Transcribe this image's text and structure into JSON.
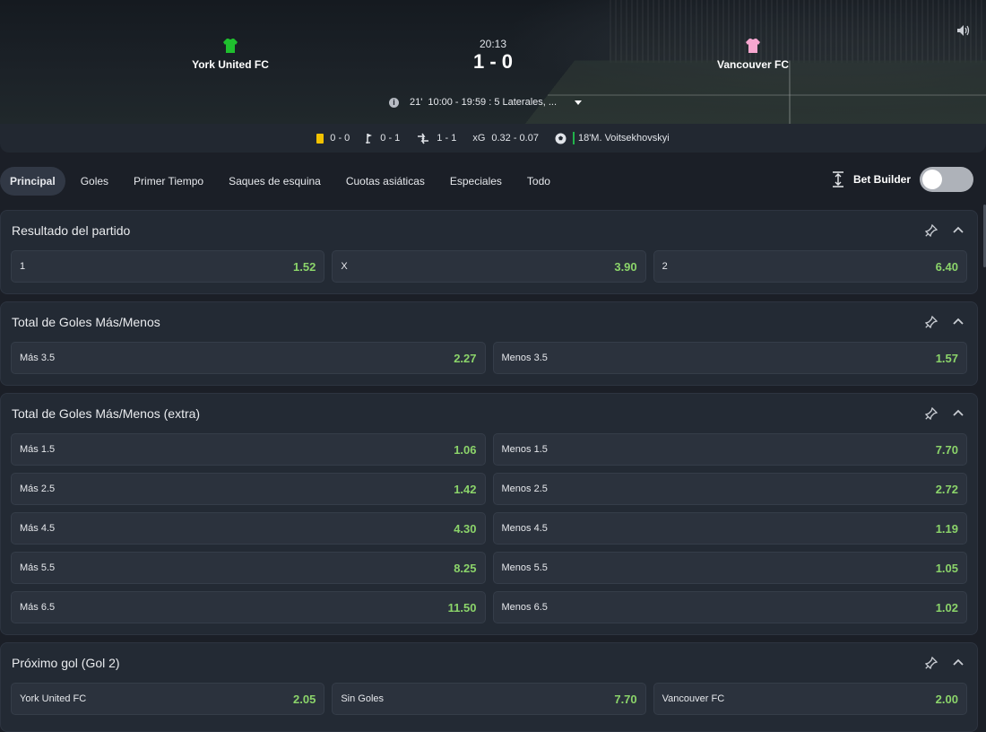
{
  "match": {
    "home_team": "York  United  FC",
    "away_team": "Vancouver  FC",
    "home_color": "#1fbf2e",
    "away_color": "#f7a6cf",
    "clock": "20:13",
    "score": "1 - 0",
    "minute": "21'",
    "info_text": "10:00 - 19:59 : 5 Laterales, ...",
    "icons": {
      "sound": "speaker-icon",
      "info": "info-icon",
      "expand": "caret-down-icon"
    }
  },
  "stats": {
    "cards": "0 - 0",
    "corners": "0 - 1",
    "substitutions": "1 - 1",
    "xg_label": "xG",
    "xg_value": "0.32 - 0.07",
    "goal": "18'M. Voitsekhovskyi"
  },
  "tabs": [
    "Principal",
    "Goles",
    "Primer Tiempo",
    "Saques de esquina",
    "Cuotas asiáticas",
    "Especiales",
    "Todo"
  ],
  "active_tab": "Principal",
  "bet_builder": {
    "label": "Bet Builder",
    "enabled": false
  },
  "colors": {
    "odds": "#8bd46a",
    "panel": "#232a34",
    "accent_goal": "#21b24a",
    "card": "#f2c200"
  },
  "markets": [
    {
      "title": "Resultado del partido",
      "rows": [
        [
          {
            "label": "1",
            "value": "1.52"
          },
          {
            "label": "X",
            "value": "3.90"
          },
          {
            "label": "2",
            "value": "6.40"
          }
        ]
      ]
    },
    {
      "title": "Total de Goles Más/Menos",
      "rows": [
        [
          {
            "label": "Más 3.5",
            "value": "2.27"
          },
          {
            "label": "Menos 3.5",
            "value": "1.57"
          }
        ]
      ]
    },
    {
      "title": "Total de Goles Más/Menos (extra)",
      "rows": [
        [
          {
            "label": "Más 1.5",
            "value": "1.06"
          },
          {
            "label": "Menos 1.5",
            "value": "7.70"
          }
        ],
        [
          {
            "label": "Más 2.5",
            "value": "1.42"
          },
          {
            "label": "Menos 2.5",
            "value": "2.72"
          }
        ],
        [
          {
            "label": "Más 4.5",
            "value": "4.30"
          },
          {
            "label": "Menos 4.5",
            "value": "1.19"
          }
        ],
        [
          {
            "label": "Más 5.5",
            "value": "8.25"
          },
          {
            "label": "Menos 5.5",
            "value": "1.05"
          }
        ],
        [
          {
            "label": "Más 6.5",
            "value": "11.50"
          },
          {
            "label": "Menos 6.5",
            "value": "1.02"
          }
        ]
      ]
    },
    {
      "title": "Próximo gol (Gol 2)",
      "rows": [
        [
          {
            "label": "York United FC",
            "value": "2.05"
          },
          {
            "label": "Sin Goles",
            "value": "7.70"
          },
          {
            "label": "Vancouver FC",
            "value": "2.00"
          }
        ]
      ]
    }
  ]
}
